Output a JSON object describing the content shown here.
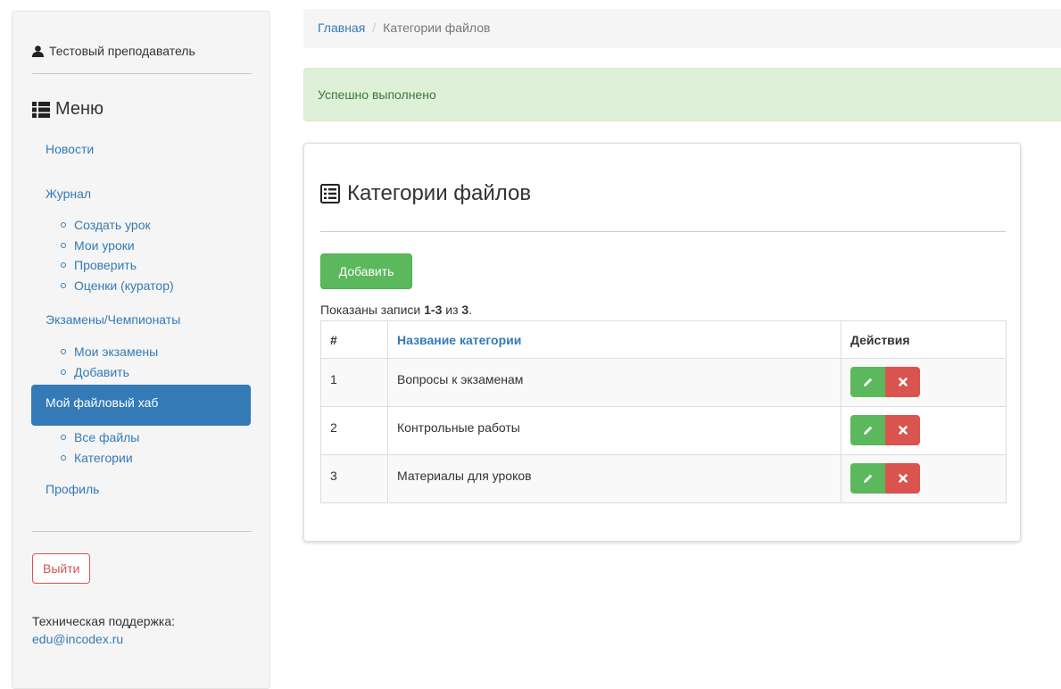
{
  "sidebar": {
    "user_name": "Тестовый преподаватель",
    "menu_title": "Меню",
    "items": {
      "news": "Новости",
      "journal": "Журнал",
      "journal_sub": [
        "Создать урок",
        "Мои уроки",
        "Проверить",
        "Оценки (куратор)"
      ],
      "exams": "Экзамены/Чемпионаты",
      "exams_sub": [
        "Мои экзамены",
        "Добавить"
      ],
      "filehub": "Мой файловый хаб",
      "filehub_sub": [
        "Все файлы",
        "Категории"
      ],
      "profile": "Профиль"
    },
    "logout_label": "Выйти",
    "support_label": "Техническая поддержка:",
    "support_email": "edu@incodex.ru"
  },
  "breadcrumb": {
    "home": "Главная",
    "separator": "/",
    "current": "Категории файлов"
  },
  "alert": {
    "message": "Успешно выполнено"
  },
  "panel": {
    "title": "Категории файлов",
    "add_label": "Добавить",
    "summary": {
      "prefix": "Показаны записи ",
      "range": "1-3",
      "middle": " из ",
      "total": "3",
      "suffix": "."
    },
    "table": {
      "headers": {
        "num": "#",
        "name": "Название категории",
        "actions": "Действия"
      },
      "rows": [
        {
          "num": "1",
          "name": "Вопросы к экзаменам"
        },
        {
          "num": "2",
          "name": "Контрольные работы"
        },
        {
          "num": "3",
          "name": "Материалы для уроков"
        }
      ]
    }
  },
  "icons": [
    "user-icon",
    "list-icon",
    "list-alt-icon",
    "pencil-icon",
    "remove-icon"
  ],
  "colors": {
    "primary": "#337ab7",
    "success": "#5cb85c",
    "danger": "#d9534f",
    "alert_bg": "#dff0d8",
    "alert_text": "#3c763d"
  }
}
